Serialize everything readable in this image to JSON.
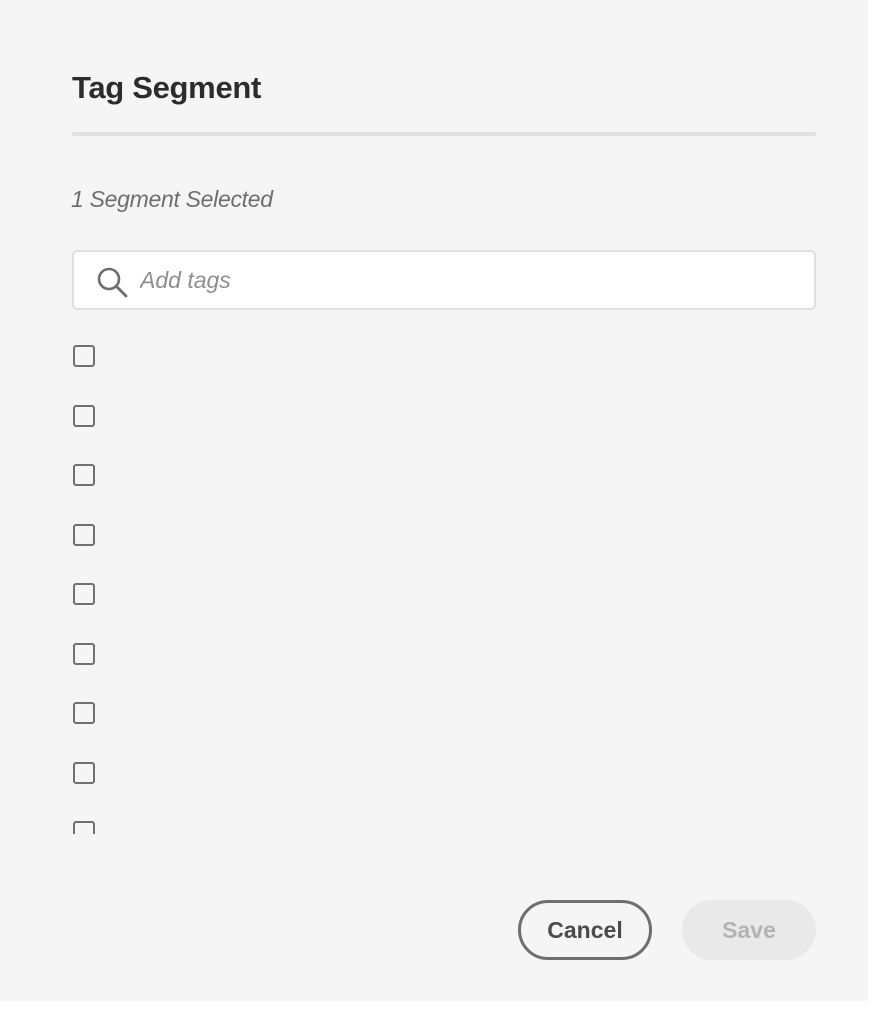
{
  "dialog": {
    "title": "Tag Segment",
    "selected_count": "1 Segment Selected"
  },
  "search": {
    "placeholder": "Add tags",
    "value": "",
    "icon": "search-icon"
  },
  "tags": [
    {
      "label": "",
      "checked": false
    },
    {
      "label": "",
      "checked": false
    },
    {
      "label": "",
      "checked": false
    },
    {
      "label": "",
      "checked": false
    },
    {
      "label": "",
      "checked": false
    },
    {
      "label": "",
      "checked": false
    },
    {
      "label": "",
      "checked": false
    },
    {
      "label": "",
      "checked": false
    },
    {
      "label": "",
      "checked": false
    }
  ],
  "footer": {
    "cancel_label": "Cancel",
    "save_label": "Save",
    "save_enabled": false
  },
  "colors": {
    "background": "#f5f5f5",
    "title_text": "#2c2c2c",
    "muted_text": "#6e6e6e",
    "checkbox_border": "#707070",
    "save_disabled_bg": "#e9e9e9",
    "save_disabled_text": "#b3b3b3"
  }
}
